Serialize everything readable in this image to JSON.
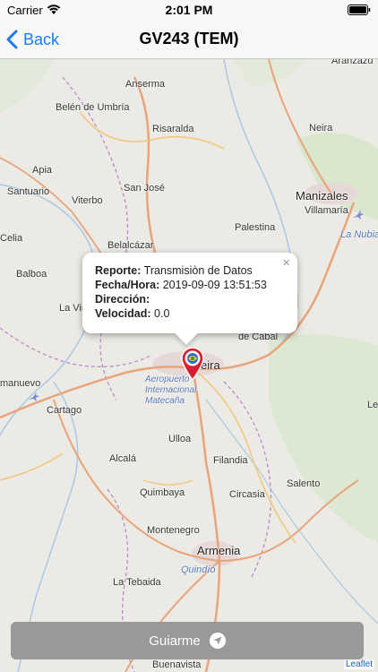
{
  "status_bar": {
    "carrier": "Carrier",
    "time": "2:01 PM"
  },
  "nav": {
    "back_label": "Back",
    "title": "GV243 (TEM)"
  },
  "map": {
    "places": [
      {
        "name": "Anserma",
        "key": "anserma"
      },
      {
        "name": "Belén de Umbría",
        "key": "belen"
      },
      {
        "name": "Risaralda",
        "key": "risaralda"
      },
      {
        "name": "Apia",
        "key": "apia"
      },
      {
        "name": "Santuario",
        "key": "santuario"
      },
      {
        "name": "Viterbo",
        "key": "viterbo"
      },
      {
        "name": "San José",
        "key": "sanjose"
      },
      {
        "name": "Manizales",
        "key": "manizales"
      },
      {
        "name": "Villamaría",
        "key": "villamaria"
      },
      {
        "name": "Neira",
        "key": "neira"
      },
      {
        "name": "Aranzazu",
        "key": "aranzazu"
      },
      {
        "name": "La Nubia",
        "key": "lanubia"
      },
      {
        "name": "Palestina",
        "key": "palestina"
      },
      {
        "name": "Celia",
        "key": "celia"
      },
      {
        "name": "Belalcázar",
        "key": "belalcazar"
      },
      {
        "name": "Balboa",
        "key": "balboa"
      },
      {
        "name": "La Virginia",
        "key": "lavirginia"
      },
      {
        "name": "de Cabal",
        "key": "cabal"
      },
      {
        "name": "eira",
        "key": "pereira"
      },
      {
        "name": "Aeropuerto Internacional Matecaña",
        "key": "airport"
      },
      {
        "name": "manuevo",
        "key": "anuevo"
      },
      {
        "name": "Cartago",
        "key": "cartago"
      },
      {
        "name": "Ulloa",
        "key": "ulloa"
      },
      {
        "name": "Alcalá",
        "key": "alcala"
      },
      {
        "name": "Filandia",
        "key": "filandia"
      },
      {
        "name": "Salento",
        "key": "salento"
      },
      {
        "name": "Quimbaya",
        "key": "quimbaya"
      },
      {
        "name": "Circasia",
        "key": "circasia"
      },
      {
        "name": "Montenegro",
        "key": "montenegro"
      },
      {
        "name": "Armenia",
        "key": "armenia"
      },
      {
        "name": "Quindío",
        "key": "quindio"
      },
      {
        "name": "La Tebaida",
        "key": "latebaida"
      },
      {
        "name": "Buenavista",
        "key": "buenavista"
      },
      {
        "name": "Le",
        "key": "le"
      }
    ]
  },
  "popup": {
    "close": "×",
    "rows": [
      {
        "label": "Reporte:",
        "value": "Transmisiòn de Datos"
      },
      {
        "label": "Fecha/Hora:",
        "value": "2019-09-09 13:51:53"
      },
      {
        "label": "Dirección:",
        "value": ""
      },
      {
        "label": "Velocidad:",
        "value": "0.0"
      }
    ]
  },
  "attribution": "Leaflet",
  "guide_button": {
    "label": "Guiarme",
    "color": "#999999"
  },
  "colors": {
    "accent": "#1a7bff",
    "marker": "#d42030"
  }
}
